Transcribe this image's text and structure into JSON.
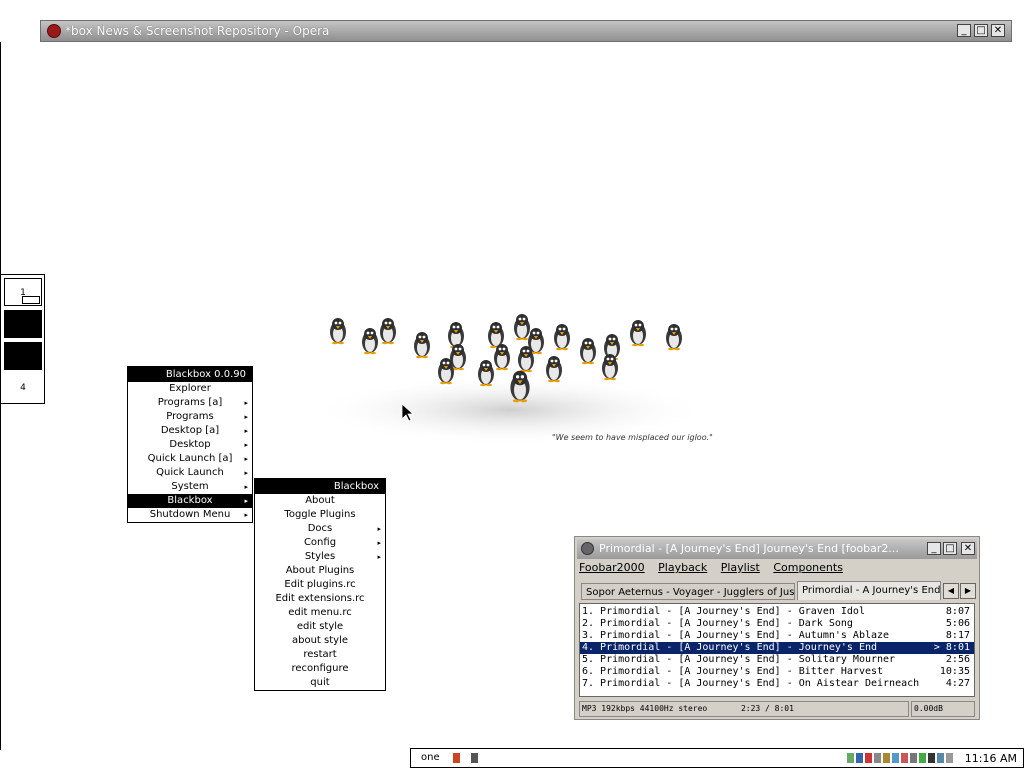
{
  "opera": {
    "title": "*box News & Screenshot Repository - Opera",
    "buttons": {
      "minimize": "_",
      "maximize": "□",
      "close": "✕"
    }
  },
  "pager": {
    "workspaces": [
      {
        "label": "1",
        "state": "current"
      },
      {
        "label": "",
        "state": "filled"
      },
      {
        "label": "",
        "state": "filled"
      },
      {
        "label": "4",
        "state": "empty"
      }
    ]
  },
  "wallpaper": {
    "caption": "\"We seem to have misplaced our igloo.\""
  },
  "main_menu": {
    "title": "Blackbox 0.0.90",
    "items": [
      {
        "label": "Explorer",
        "submenu": false
      },
      {
        "label": "Programs [a]",
        "submenu": true
      },
      {
        "label": "Programs",
        "submenu": true
      },
      {
        "label": "Desktop [a]",
        "submenu": true
      },
      {
        "label": "Desktop",
        "submenu": true
      },
      {
        "label": "Quick Launch [a]",
        "submenu": true
      },
      {
        "label": "Quick Launch",
        "submenu": true
      },
      {
        "label": "System",
        "submenu": true
      },
      {
        "label": "Blackbox",
        "submenu": true,
        "active": true
      },
      {
        "label": "Shutdown Menu",
        "submenu": true
      }
    ]
  },
  "blackbox_menu": {
    "title": "Blackbox",
    "items": [
      {
        "label": "About",
        "submenu": false
      },
      {
        "label": "Toggle Plugins",
        "submenu": false
      },
      {
        "label": "Docs",
        "submenu": true
      },
      {
        "label": "Config",
        "submenu": true
      },
      {
        "label": "Styles",
        "submenu": true
      },
      {
        "label": "About Plugins",
        "submenu": false
      },
      {
        "label": "Edit plugins.rc",
        "submenu": false
      },
      {
        "label": "Edit extensions.rc",
        "submenu": false
      },
      {
        "label": "edit menu.rc",
        "submenu": false
      },
      {
        "label": "edit style",
        "submenu": false
      },
      {
        "label": "about style",
        "submenu": false
      },
      {
        "label": "restart",
        "submenu": false
      },
      {
        "label": "reconfigure",
        "submenu": false
      },
      {
        "label": "quit",
        "submenu": false
      }
    ]
  },
  "foobar": {
    "title": "Primordial - [A Journey's End] Journey's End    [foobar2...",
    "menu": [
      "Foobar2000",
      "Playback",
      "Playlist",
      "Components"
    ],
    "tabs": [
      {
        "label": "Sopor Aeternus - Voyager - Jugglers of Jusa",
        "active": false
      },
      {
        "label": "Primordial - A Journey's End",
        "active": true
      }
    ],
    "tracks": [
      {
        "text": "1. Primordial - [A Journey's End] - Graven Idol",
        "duration": "8:07"
      },
      {
        "text": "2. Primordial - [A Journey's End] - Dark Song",
        "duration": "5:06"
      },
      {
        "text": "3. Primordial - [A Journey's End] - Autumn's Ablaze",
        "duration": "8:17"
      },
      {
        "text": "4. Primordial - [A Journey's End] - Journey's End",
        "duration": "> 8:01",
        "selected": true
      },
      {
        "text": "5. Primordial - [A Journey's End] - Solitary Mourner",
        "duration": "2:56"
      },
      {
        "text": "6. Primordial - [A Journey's End] - Bitter Harvest",
        "duration": "10:35"
      },
      {
        "text": "7. Primordial - [A Journey's End] - On Aistear Deirneach",
        "duration": "4:27"
      }
    ],
    "status": "MP3 192kbps 44100Hz stereo       2:23 / 8:01",
    "volume": "0.00dB"
  },
  "taskbar": {
    "workspace": "one",
    "clock": "11:16 AM"
  },
  "colors": {
    "selection": "#0a246a",
    "menu_title": "#000000",
    "face": "#d4d0c8"
  }
}
